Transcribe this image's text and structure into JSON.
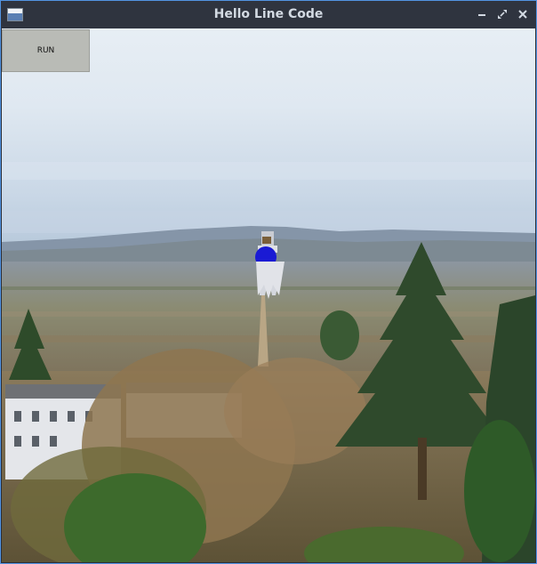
{
  "window": {
    "title": "Hello Line Code",
    "controls": {
      "minimize": "minimize-icon",
      "maximize": "maximize-icon",
      "close": "close-icon"
    }
  },
  "toolbar": {
    "run_label": "RUN"
  },
  "colors": {
    "accent_border": "#5294e2",
    "titlebar_bg": "#2f343f",
    "sprite_blue": "#1a1ad4"
  }
}
